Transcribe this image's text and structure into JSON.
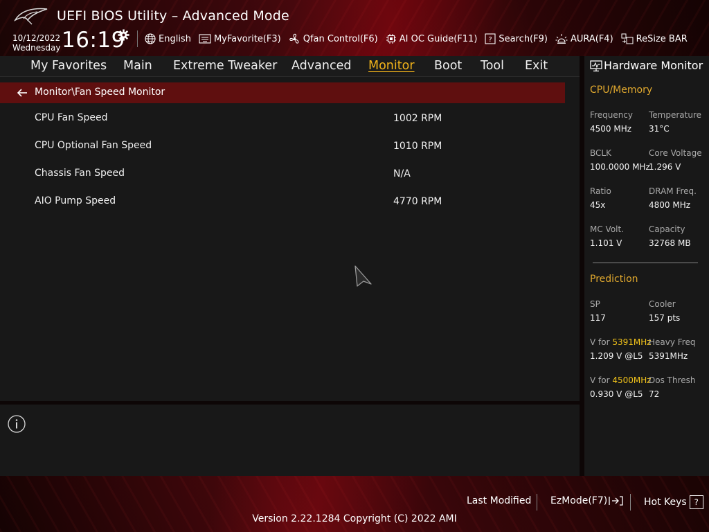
{
  "header": {
    "title": "UEFI BIOS Utility – Advanced Mode",
    "date": "10/12/2022",
    "day": "Wednesday",
    "time": "16:19",
    "toolbar": {
      "language": "English",
      "myfavorite": "MyFavorite(F3)",
      "qfan": "Qfan Control(F6)",
      "ai_oc": "AI OC Guide(F11)",
      "search": "Search(F9)",
      "aura": "AURA(F4)",
      "resize_bar": "ReSize BAR"
    }
  },
  "tabs": [
    "My Favorites",
    "Main",
    "Extreme Tweaker",
    "Advanced",
    "Monitor",
    "Boot",
    "Tool",
    "Exit"
  ],
  "active_tab": "Monitor",
  "breadcrumb": "Monitor\\Fan Speed Monitor",
  "rows": [
    {
      "label": "CPU Fan Speed",
      "value": "1002 RPM"
    },
    {
      "label": "CPU Optional Fan Speed",
      "value": "1010 RPM"
    },
    {
      "label": "Chassis Fan Speed",
      "value": "N/A"
    },
    {
      "label": "AIO Pump Speed",
      "value": "4770 RPM"
    }
  ],
  "hw": {
    "title": "Hardware Monitor",
    "cpu_memory": {
      "title": "CPU/Memory",
      "frequency_label": "Frequency",
      "frequency": "4500 MHz",
      "temperature_label": "Temperature",
      "temperature": "31°C",
      "bclk_label": "BCLK",
      "bclk": "100.0000 MHz",
      "core_voltage_label": "Core Voltage",
      "core_voltage": "1.296 V",
      "ratio_label": "Ratio",
      "ratio": "45x",
      "dram_freq_label": "DRAM Freq.",
      "dram_freq": "4800 MHz",
      "mc_volt_label": "MC Volt.",
      "mc_volt": "1.101 V",
      "capacity_label": "Capacity",
      "capacity": "32768 MB"
    },
    "prediction": {
      "title": "Prediction",
      "sp_label": "SP",
      "sp": "117",
      "cooler_label": "Cooler",
      "cooler": "157 pts",
      "v_for_prefix": "V for ",
      "v_for_1_freq": "5391MHz",
      "v_for_1": "1.209 V @L5",
      "heavy_freq_label": "Heavy Freq",
      "heavy_freq": "5391MHz",
      "v_for_2_freq": "4500MHz",
      "v_for_2": "0.930 V @L5",
      "dos_thresh_label": "Dos Thresh",
      "dos_thresh": "72"
    }
  },
  "footer": {
    "last_modified": "Last Modified",
    "ezmode": "EzMode(F7)",
    "hot_keys": "Hot Keys",
    "hot_keys_glyph": "?",
    "version": "Version 2.22.1284 Copyright (C) 2022 AMI"
  },
  "colors": {
    "accent": "#f2b31a",
    "section_title": "#e0a82e",
    "breadcrumb_bg": "#5f0f0f",
    "panel_bg": "#181818"
  }
}
